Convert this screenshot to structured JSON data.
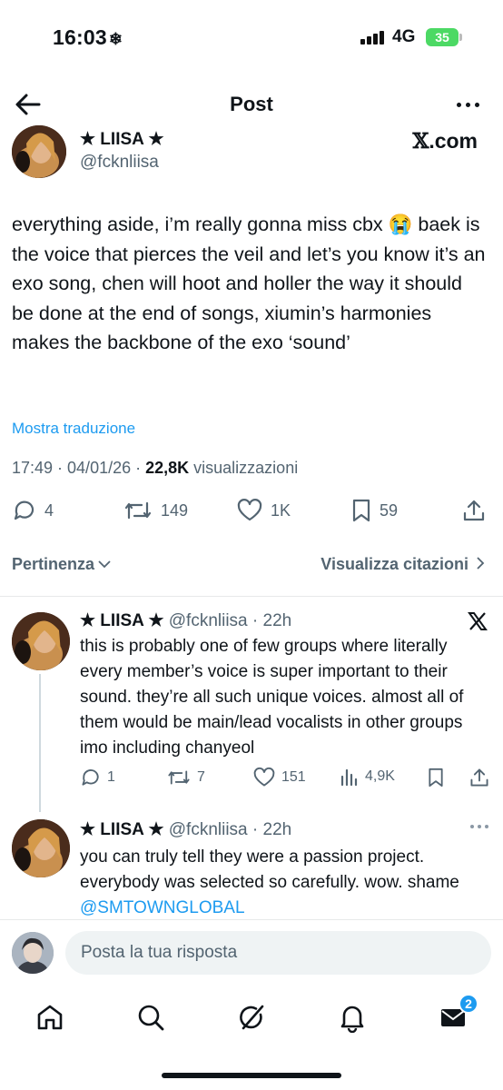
{
  "status": {
    "time": "16:03",
    "network": "4G",
    "battery": "35"
  },
  "header": {
    "title": "Post"
  },
  "post": {
    "author_name": "★ LIISA ★",
    "handle": "@fcknliisa",
    "source_badge": ".com",
    "text": "everything aside, i’m really gonna miss cbx 😭 baek is the voice that pierces the veil and let’s you know it’s an exo song, chen will hoot and holler the way it should be done at the end of songs, xiumin’s harmonies makes the backbone of the exo ‘sound’",
    "translate": "Mostra traduzione",
    "datetime": "17:49 · 04/01/26 · ",
    "views_count": "22,8K",
    "views_label": " visualizzazioni",
    "replies": "4",
    "reposts": "149",
    "likes": "1K",
    "bookmarks": "59"
  },
  "sort": {
    "left": "Pertinenza",
    "right": "Visualizza citazioni"
  },
  "replies": [
    {
      "name": "★ LIISA ★",
      "handle": " @fcknliisa · 22h",
      "text": "this is probably one of few groups where literally every member’s voice is super important to their sound. they’re all such unique voices. almost all of them would be main/lead vocalists in other groups imo including chanyeol",
      "replies": "1",
      "reposts": "7",
      "likes": "151",
      "views": "4,9K"
    },
    {
      "name": "★ LIISA ★",
      "handle": " @fcknliisa · 22h",
      "text": "you can truly tell they were a passion project. everybody was selected so carefully. wow. shame ",
      "mention": "@SMTOWNGLOBAL"
    }
  ],
  "compose": {
    "placeholder": "Posta la tua risposta"
  },
  "tabbar": {
    "messages_badge": "2"
  },
  "colors": {
    "accent": "#1d9bf0",
    "text": "#0f1419",
    "secondary": "#536471",
    "battery": "#4cd964"
  },
  "icons": [
    "back-arrow-icon",
    "more-icon",
    "x-logo-icon",
    "reply-icon",
    "repost-icon",
    "like-icon",
    "bookmark-icon",
    "share-icon",
    "views-icon",
    "home-icon",
    "search-icon",
    "grok-icon",
    "bell-icon",
    "mail-icon"
  ]
}
